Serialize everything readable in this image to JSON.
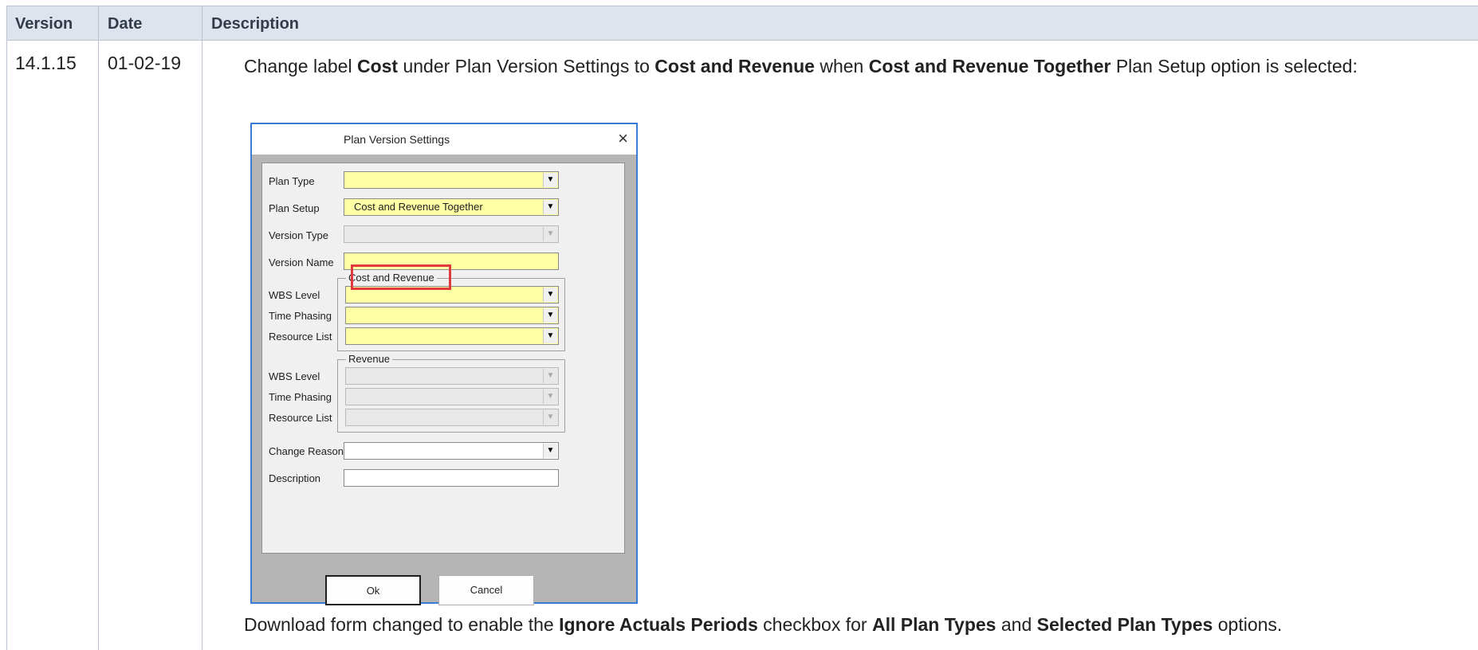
{
  "table": {
    "headers": {
      "version": "Version",
      "date": "Date",
      "description": "Description"
    },
    "row": {
      "version": "14.1.15",
      "date": "01-02-19",
      "description_parts": [
        {
          "text": "Change label ",
          "bold": false
        },
        {
          "text": "Cost",
          "bold": true
        },
        {
          "text": " under Plan Version Settings to ",
          "bold": false
        },
        {
          "text": "Cost and Revenue",
          "bold": true
        },
        {
          "text": " when ",
          "bold": false
        },
        {
          "text": "Cost and Revenue Together",
          "bold": true
        },
        {
          "text": " Plan Setup option is selected:",
          "bold": false
        }
      ],
      "description2_parts": [
        {
          "text": "Download form changed to enable the ",
          "bold": false
        },
        {
          "text": "Ignore Actuals Periods",
          "bold": true
        },
        {
          "text": " checkbox for ",
          "bold": false
        },
        {
          "text": "All Plan Types",
          "bold": true
        },
        {
          "text": " and ",
          "bold": false
        },
        {
          "text": "Selected Plan Types",
          "bold": true
        },
        {
          "text": " options.",
          "bold": false
        }
      ]
    }
  },
  "dialog": {
    "title": "Plan Version Settings",
    "close_icon": "×",
    "labels": {
      "plan_type": "Plan Type",
      "plan_setup": "Plan Setup",
      "version_type": "Version Type",
      "version_name": "Version Name",
      "wbs_level": "WBS Level",
      "time_phasing": "Time Phasing",
      "resource_list": "Resource List",
      "change_reason": "Change Reason",
      "description": "Description"
    },
    "plan_setup_value": "Cost and Revenue Together",
    "group_cost_revenue": "Cost and Revenue",
    "group_revenue": "Revenue",
    "ok_label": "Ok",
    "cancel_label": "Cancel",
    "dropdown_glyph": "▼"
  },
  "colors": {
    "header_bg": "#dde4ee",
    "required_field": "#ffffa6",
    "highlight_box": "#e0393e",
    "dialog_border": "#3a7bd5"
  }
}
